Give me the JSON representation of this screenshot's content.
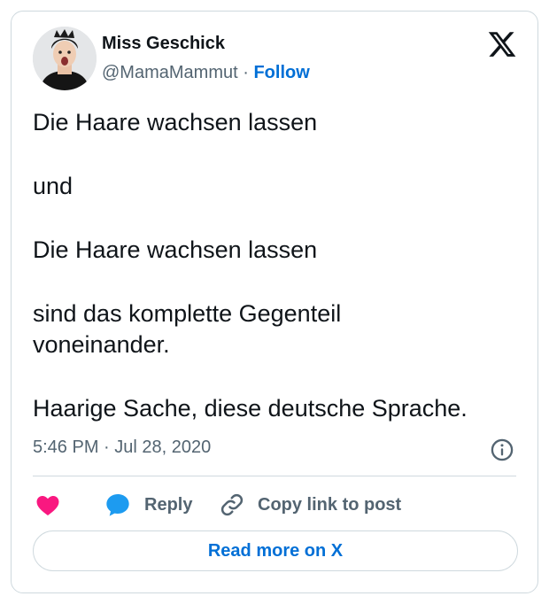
{
  "author": {
    "display_name": "Miss Geschick",
    "handle": "@MamaMammut",
    "separator": "·",
    "follow_label": "Follow"
  },
  "brand_icon": "x-logo-icon",
  "post": {
    "lines": [
      "Die Haare wachsen lassen",
      "und",
      "Die Haare wachsen lassen",
      "sind das komplette Gegenteil voneinander.",
      "Haarige Sache, diese deutsche Sprache."
    ],
    "timestamp": "5:46 PM · Jul 28, 2020"
  },
  "actions": {
    "like_icon": "heart-icon",
    "reply_icon": "speech-bubble-icon",
    "reply_label": "Reply",
    "copy_icon": "link-icon",
    "copy_label": "Copy link to post",
    "info_icon": "info-icon"
  },
  "read_more_label": "Read more on X",
  "colors": {
    "accent": "#006fd6",
    "like": "#f91880",
    "reply_bubble": "#1d9bf0",
    "secondary_text": "#536471",
    "border": "#cfd9de"
  }
}
